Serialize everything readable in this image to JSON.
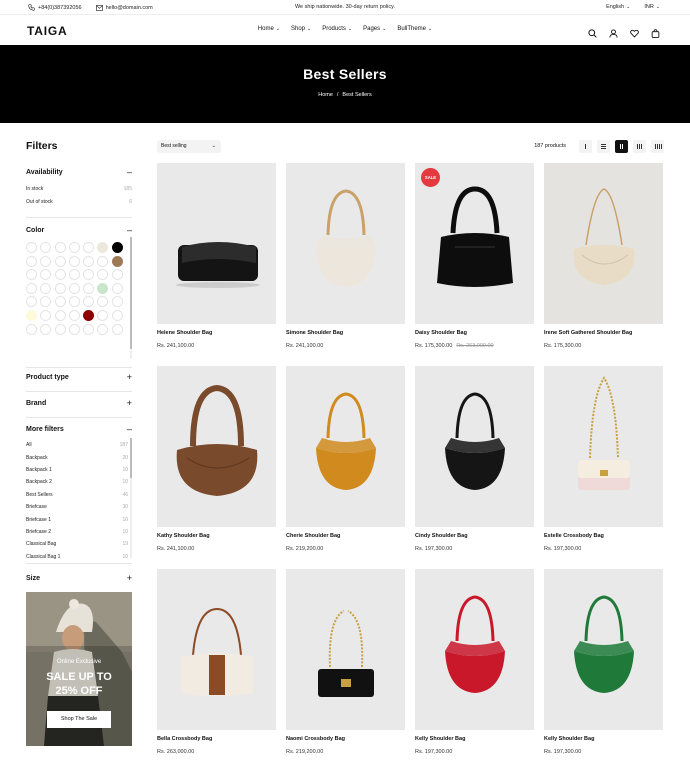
{
  "topbar": {
    "phone": "+84(0)387392056",
    "email": "hello@domain.com",
    "announcement": "We ship nationwide. 30-day return policy.",
    "language": "English",
    "currency": "INR"
  },
  "header": {
    "logo": "TAIGA",
    "nav": [
      {
        "label": "Home"
      },
      {
        "label": "Shop"
      },
      {
        "label": "Products"
      },
      {
        "label": "Pages"
      },
      {
        "label": "BullTheme"
      }
    ],
    "icons": [
      "search-icon",
      "user-icon",
      "heart-icon",
      "bag-icon"
    ]
  },
  "hero": {
    "title": "Best Sellers",
    "crumb_home": "Home",
    "crumb_sep": "/",
    "crumb_current": "Best Sellers"
  },
  "filters": {
    "title": "Filters",
    "availability": {
      "label": "Availability",
      "options": [
        {
          "label": "In stock",
          "count": "185"
        },
        {
          "label": "Out of stock",
          "count": "6"
        }
      ]
    },
    "color": {
      "label": "Color",
      "swatches": [
        "#ffffff",
        "#ffffff",
        "#ffffff",
        "#ffffff",
        "#ffffff",
        "#ebe8dc",
        "#000000",
        "#ffffff",
        "#ffffff",
        "#ffffff",
        "#ffffff",
        "#ffffff",
        "#ffffff",
        "#9c7a57",
        "#ffffff",
        "#ffffff",
        "#ffffff",
        "#ffffff",
        "#ffffff",
        "#ffffff",
        "#ffffff",
        "#ffffff",
        "#ffffff",
        "#ffffff",
        "#ffffff",
        "#ffffff",
        "#c8e6c9",
        "#ffffff",
        "#ffffff",
        "#ffffff",
        "#ffffff",
        "#ffffff",
        "#ffffff",
        "#ffffff",
        "#ffffff",
        "#fdfbd8",
        "#ffffff",
        "#ffffff",
        "#ffffff",
        "#8b0000",
        "#ffffff",
        "#ffffff",
        "#ffffff",
        "#ffffff",
        "#ffffff",
        "#ffffff",
        "#ffffff",
        "#ffffff",
        "#ffffff"
      ]
    },
    "product_type": {
      "label": "Product type"
    },
    "brand": {
      "label": "Brand"
    },
    "more": {
      "label": "More filters",
      "options": [
        {
          "label": "All",
          "count": "187"
        },
        {
          "label": "Backpack",
          "count": "20"
        },
        {
          "label": "Backpack 1",
          "count": "10"
        },
        {
          "label": "Backpack 2",
          "count": "10"
        },
        {
          "label": "Best Sellers",
          "count": "46"
        },
        {
          "label": "Briefcase",
          "count": "30"
        },
        {
          "label": "Briefcase 1",
          "count": "10"
        },
        {
          "label": "Briefcase 2",
          "count": "10"
        },
        {
          "label": "Classical Bag",
          "count": "19"
        },
        {
          "label": "Classical Bag 1",
          "count": "10"
        }
      ]
    },
    "size": {
      "label": "Size"
    },
    "promo": {
      "kicker": "Online Exclusive",
      "line1": "SALE UP TO",
      "line2": "25% OFF",
      "button": "Shop The Sale"
    }
  },
  "toolbar": {
    "sort_value": "Best selling",
    "count": "187 products",
    "active_view": 4
  },
  "products": [
    {
      "name": "Helene Shoulder Bag",
      "price": "Rs. 241,100.00",
      "old_price": "",
      "badge": "",
      "bag_color": "#141414",
      "shape": "flap"
    },
    {
      "name": "Simone Shoulder Bag",
      "price": "Rs. 241,100.00",
      "old_price": "",
      "badge": "",
      "bag_color": "#ece6dc",
      "shape": "hobo"
    },
    {
      "name": "Daisy Shoulder Bag",
      "price": "Rs. 175,300.00",
      "old_price": "Rs. 263,000.00",
      "badge": "SALE",
      "bag_color": "#0d0d0d",
      "shape": "tote"
    },
    {
      "name": "Irene Soft Gathered Shoulder Bag",
      "price": "Rs. 175,300.00",
      "old_price": "",
      "badge": "",
      "bag_color": "#e8dcc6",
      "shape": "pouch"
    },
    {
      "name": "Kathy Shoulder Bag",
      "price": "Rs. 241,100.00",
      "old_price": "",
      "badge": "",
      "bag_color": "#7a4a2c",
      "shape": "bigpouch"
    },
    {
      "name": "Cherie Shoulder Bag",
      "price": "Rs. 219,200.00",
      "old_price": "",
      "badge": "",
      "bag_color": "#d08a1e",
      "shape": "hobo"
    },
    {
      "name": "Cindy Shoulder Bag",
      "price": "Rs. 197,300.00",
      "old_price": "",
      "badge": "",
      "bag_color": "#151515",
      "shape": "hobo"
    },
    {
      "name": "Estelle Crossbody Bag",
      "price": "Rs. 197,300.00",
      "old_price": "",
      "badge": "",
      "bag_color": "#f0d9d9",
      "shape": "chainflap"
    },
    {
      "name": "Bella Crossbody Bag",
      "price": "Rs. 263,000.00",
      "old_price": "",
      "badge": "",
      "bag_color": "#f1ebe2",
      "shape": "baguette"
    },
    {
      "name": "Naomi Crossbody Bag",
      "price": "Rs. 219,200.00",
      "old_price": "",
      "badge": "",
      "bag_color": "#111111",
      "shape": "chainbox"
    },
    {
      "name": "Kelly Shoulder Bag",
      "price": "Rs. 197,300.00",
      "old_price": "",
      "badge": "",
      "bag_color": "#c8182a",
      "shape": "hobo"
    },
    {
      "name": "Kelly Shoulder Bag",
      "price": "Rs. 197,300.00",
      "old_price": "",
      "badge": "",
      "bag_color": "#1f7a3a",
      "shape": "hobo"
    }
  ]
}
